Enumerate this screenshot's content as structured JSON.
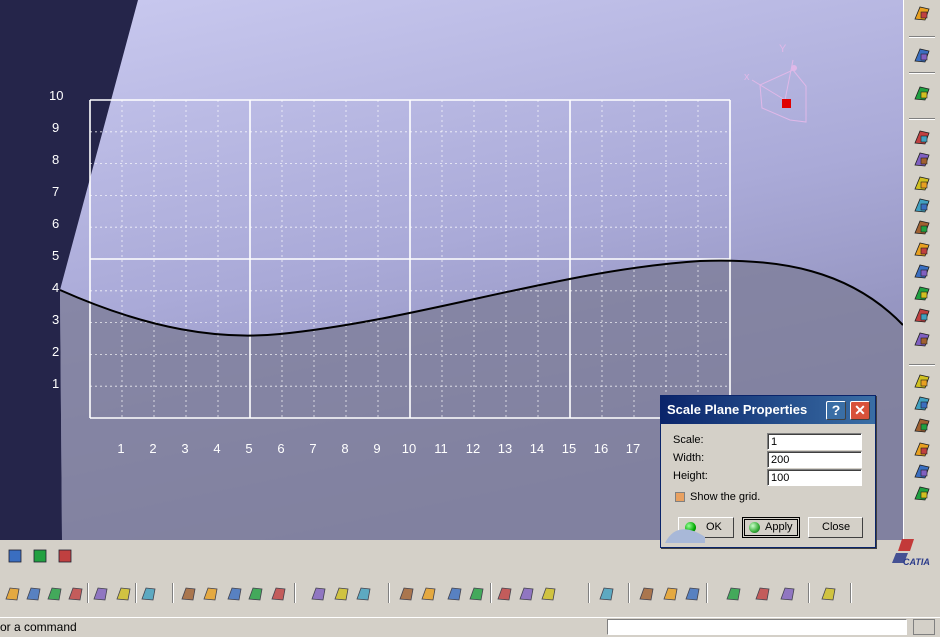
{
  "viewport": {
    "y_ticks": [
      "1",
      "2",
      "3",
      "4",
      "5",
      "6",
      "7",
      "8",
      "9",
      "10"
    ],
    "x_ticks": [
      "1",
      "2",
      "3",
      "4",
      "5",
      "6",
      "7",
      "8",
      "9",
      "10",
      "11",
      "12",
      "13",
      "14",
      "15",
      "16",
      "17"
    ],
    "compass": {
      "x_label": "x",
      "y_label": "Y"
    },
    "colors": {
      "background_top": "#c8c8ee",
      "background_bottom": "#8a8ab4",
      "shadow_panel": "#25254a",
      "curve": "#000000",
      "grid_major": "#ffffff",
      "lower_region": "#80809c"
    }
  },
  "dialog": {
    "title": "Scale Plane Properties",
    "help_glyph": "?",
    "close_glyph": "✕",
    "fields": {
      "scale": {
        "label": "Scale:",
        "value": "1"
      },
      "width": {
        "label": "Width:",
        "value": "200"
      },
      "height": {
        "label": "Height:",
        "value": "100"
      }
    },
    "show_grid": {
      "label": "Show the grid.",
      "checked": false
    },
    "buttons": {
      "ok": "OK",
      "apply": "Apply",
      "close": "Close"
    }
  },
  "status_bar": {
    "text": "or a command",
    "input_value": ""
  },
  "logo": {
    "text": "CATIA"
  },
  "icons": {
    "right_toolbar": [
      "compass-icon",
      "select-arrow-icon",
      "sketch-icon",
      "extrude-icon",
      "pocket-icon",
      "shaft-icon",
      "groove-icon",
      "hole-icon",
      "rib-icon",
      "slot-icon",
      "stiffener-icon",
      "loft-icon",
      "fillet-icon",
      "chamfer-icon",
      "draft-icon",
      "shell-icon",
      "thickness-icon",
      "mirror-icon",
      "pattern-icon",
      "transform-icon",
      "axis-system-icon"
    ],
    "bottom_toolbar": [
      "print-icon",
      "cut-icon",
      "copy-icon",
      "paste-icon",
      "undo-icon",
      "redo-icon",
      "whats-this-icon",
      "formula-icon",
      "comment-icon",
      "design-table-icon",
      "table-icon",
      "tree-icon",
      "fly-icon",
      "fit-all-icon",
      "pan-icon",
      "zoom-in-icon",
      "rotate-icon",
      "zoom-out-icon",
      "normal-view-icon",
      "views-icon",
      "render-style-icon",
      "hide-show-icon",
      "swap-icon",
      "measure-icon",
      "publish-icon",
      "part-icon",
      "apply-material-icon",
      "knowledge-icon",
      "analysis-icon",
      "check-icon"
    ]
  }
}
